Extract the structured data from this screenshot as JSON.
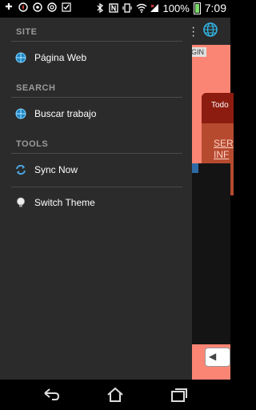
{
  "status_bar": {
    "battery": "100%",
    "time": "7:09",
    "icons": [
      "add-icon",
      "compass-icon",
      "whatsapp-icon",
      "chrome-icon",
      "check-icon",
      "bluetooth-icon",
      "nfc-icon",
      "vibrate-icon",
      "wifi-icon",
      "signal-icon",
      "battery-icon"
    ]
  },
  "app_behind": {
    "tab_label": "GIN",
    "card_header": "Todo",
    "card_link": "SER INF"
  },
  "drawer": {
    "sections": [
      {
        "title": "SITE",
        "items": [
          {
            "label": "Página Web",
            "icon": "globe-icon"
          }
        ]
      },
      {
        "title": "SEARCH",
        "items": [
          {
            "label": "Buscar trabajo",
            "icon": "globe-icon"
          }
        ]
      },
      {
        "title": "TOOLS",
        "items": [
          {
            "label": "Sync Now",
            "icon": "sync-icon"
          },
          {
            "label": "Switch Theme",
            "icon": "lightbulb-icon"
          }
        ]
      }
    ]
  },
  "nav_bar": {
    "buttons": [
      "back-icon",
      "home-icon",
      "recent-apps-icon"
    ]
  },
  "colors": {
    "drawer_bg": "#2b2b2b",
    "app_bg": "#fb8574",
    "accent_blue": "#33b5e5"
  }
}
